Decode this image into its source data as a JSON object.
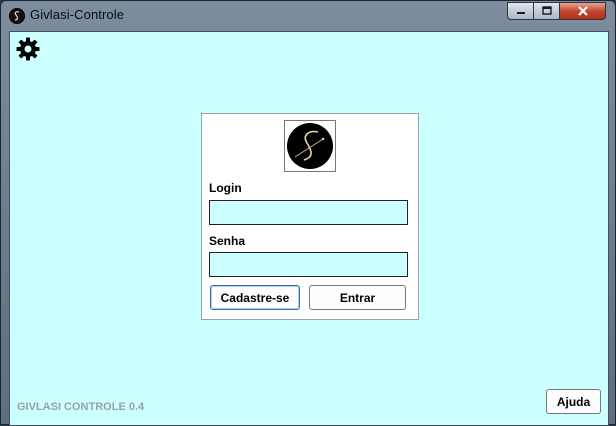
{
  "window": {
    "title": "Givlasi-Controle",
    "icon": "app-logo-icon",
    "controls": [
      "minimize-icon",
      "maximize-icon",
      "close-icon"
    ]
  },
  "toolbar": {
    "settings_icon": "gear-icon"
  },
  "login": {
    "logo_icon": "givlasi-logo",
    "login_label": "Login",
    "login_value": "",
    "password_label": "Senha",
    "password_value": "",
    "register_button": "Cadastre-se",
    "enter_button": "Entrar"
  },
  "footer": {
    "version": "GIVLASI CONTROLE 0.4",
    "help_button": "Ajuda"
  },
  "colors": {
    "background": "#ccffff",
    "panel": "#ffffff",
    "input_fill": "#ccffff",
    "close_button": "#c2422a"
  }
}
